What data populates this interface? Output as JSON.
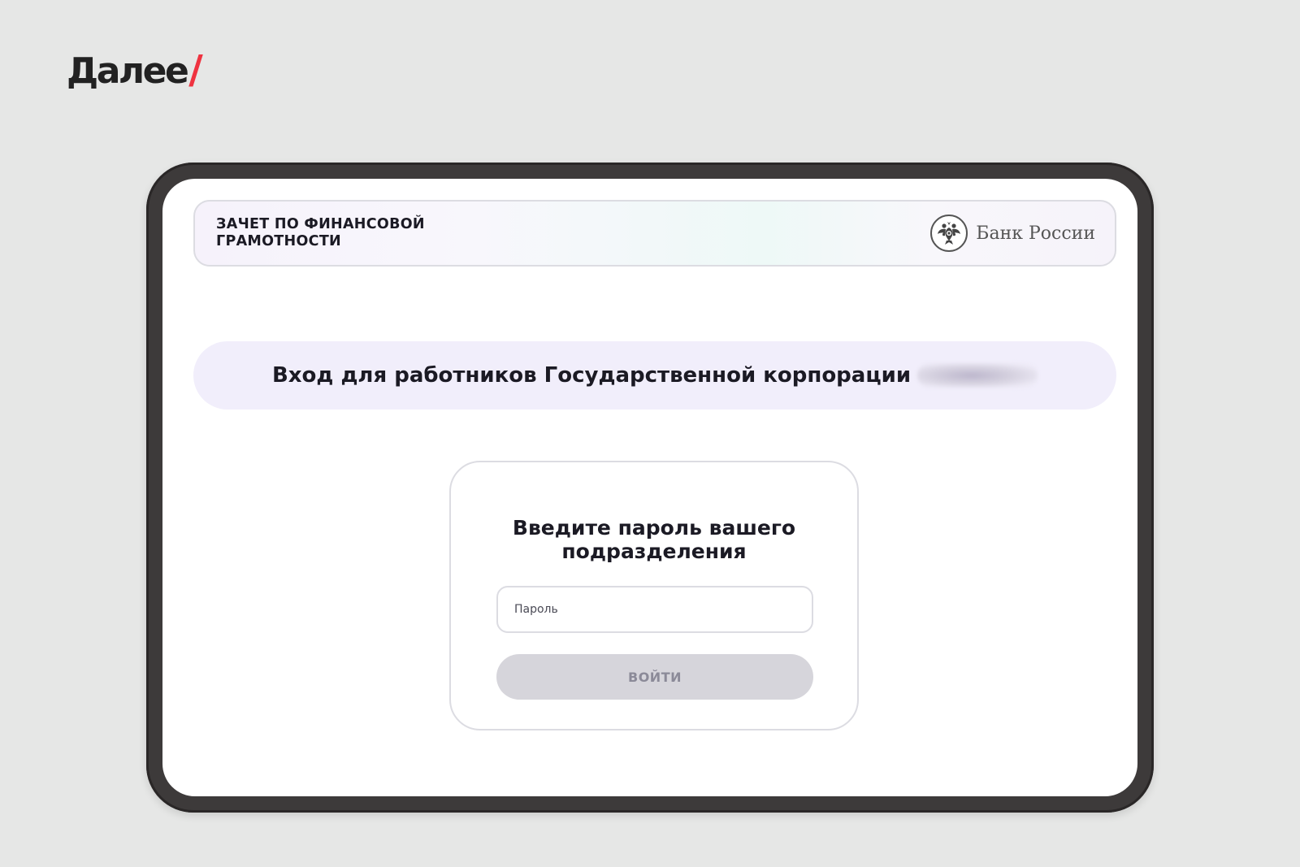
{
  "brand": {
    "name": "Далее",
    "slash": "/"
  },
  "header": {
    "title": "ЗАЧЕТ ПО ФИНАНСОВОЙ ГРАМОТНОСТИ",
    "bank_name": "Банк России",
    "emblem_icon": "double-headed-eagle-icon"
  },
  "banner": {
    "text": "Вход для работников Государственной корпорации"
  },
  "login": {
    "title": "Введите пароль вашего подразделения",
    "password_placeholder": "Пароль",
    "password_value": "",
    "submit_label": "ВОЙТИ"
  },
  "colors": {
    "background": "#e6e7e6",
    "accent_slash": "#ef3340",
    "banner_bg": "#f1eefb",
    "button_disabled_bg": "#d6d5db",
    "button_disabled_text": "#8b8a98"
  }
}
